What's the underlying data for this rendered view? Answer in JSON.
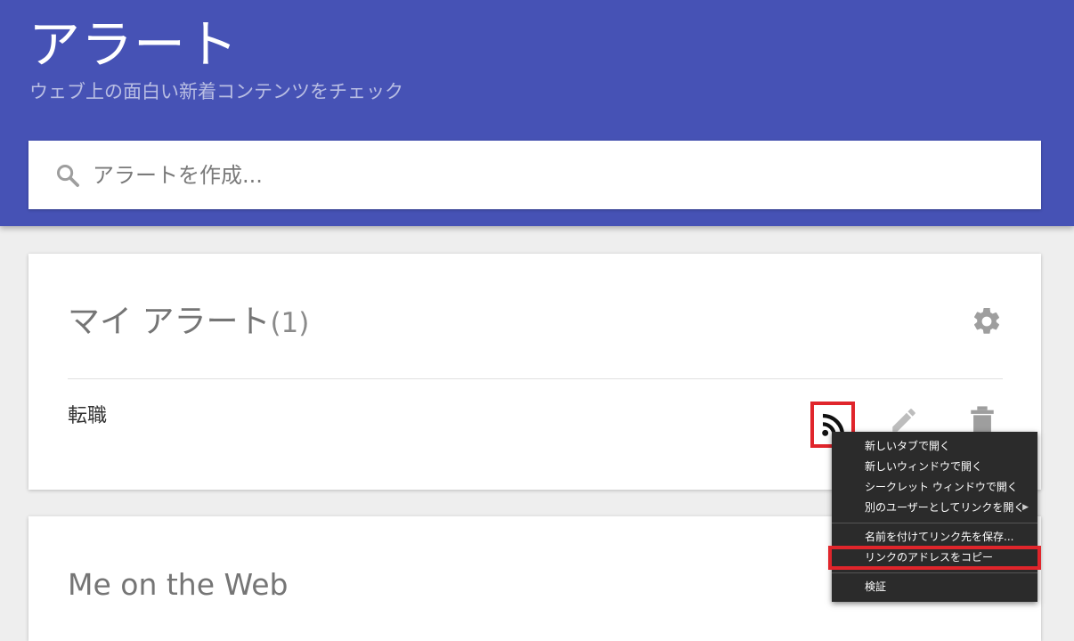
{
  "header": {
    "title": "アラート",
    "subtitle": "ウェブ上の面白い新着コンテンツをチェック"
  },
  "search": {
    "placeholder": "アラートを作成..."
  },
  "my_alerts": {
    "title": "マイ アラート",
    "count": "(1)",
    "items": [
      {
        "label": "転職"
      }
    ]
  },
  "me_on_web": {
    "title": "Me on the Web"
  },
  "context_menu": {
    "items": [
      {
        "label": "新しいタブで開く"
      },
      {
        "label": "新しいウィンドウで開く"
      },
      {
        "label": "シークレット ウィンドウで開く"
      },
      {
        "label": "別のユーザーとしてリンクを開く"
      },
      {
        "label": "名前を付けてリンク先を保存..."
      },
      {
        "label": "リンクのアドレスをコピー"
      },
      {
        "label": "検証"
      }
    ]
  },
  "colors": {
    "header_bg": "#4652b5",
    "highlight": "#e0252b",
    "menu_bg": "#2b2b2b"
  },
  "icons": [
    "search-icon",
    "gear-icon",
    "rss-icon",
    "pencil-icon",
    "trash-icon",
    "chevron-right-icon"
  ]
}
